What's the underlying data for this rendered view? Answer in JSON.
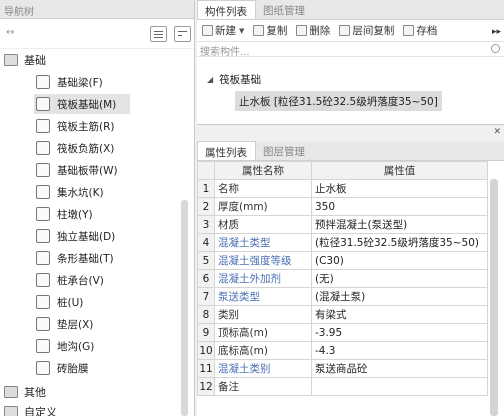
{
  "nav": {
    "title": "导航树",
    "categories": [
      {
        "label": "基础"
      },
      {
        "label": "其他"
      },
      {
        "label": "自定义"
      }
    ],
    "items": [
      {
        "label": "基础梁(F)",
        "icon": "beam-icon"
      },
      {
        "label": "筏板基础(M)",
        "icon": "raft-foundation-icon"
      },
      {
        "label": "筏板主筋(R)",
        "icon": "raft-main-rebar-icon"
      },
      {
        "label": "筏板负筋(X)",
        "icon": "raft-negative-rebar-icon"
      },
      {
        "label": "基础板带(W)",
        "icon": "slab-strip-icon"
      },
      {
        "label": "集水坑(K)",
        "icon": "sump-pit-icon"
      },
      {
        "label": "柱墩(Y)",
        "icon": "column-pier-icon"
      },
      {
        "label": "独立基础(D)",
        "icon": "isolated-footing-icon"
      },
      {
        "label": "条形基础(T)",
        "icon": "strip-footing-icon"
      },
      {
        "label": "桩承台(V)",
        "icon": "pile-cap-icon"
      },
      {
        "label": "桩(U)",
        "icon": "pile-icon"
      },
      {
        "label": "垫层(X)",
        "icon": "cushion-icon"
      },
      {
        "label": "地沟(G)",
        "icon": "trench-icon"
      },
      {
        "label": "砖胎膜",
        "icon": "brick-mold-icon"
      }
    ]
  },
  "components": {
    "tabs": [
      "构件列表",
      "图纸管理"
    ],
    "toolbar": {
      "new_label": "新建",
      "copy_label": "复制",
      "delete_label": "删除",
      "layer_copy_label": "层间复制",
      "save_label": "存档"
    },
    "search_placeholder": "搜索构件...",
    "group_label": "筏板基础",
    "item_label": "止水板 [粒径31.5砼32.5级坍落度35~50]"
  },
  "properties": {
    "tabs": [
      "属性列表",
      "图层管理"
    ],
    "columns": [
      "属性名称",
      "属性值"
    ],
    "rows": [
      {
        "num": "1",
        "name": "名称",
        "value": "止水板",
        "blue": false
      },
      {
        "num": "2",
        "name": "厚度(mm)",
        "value": "350",
        "blue": false
      },
      {
        "num": "3",
        "name": "材质",
        "value": "预拌混凝土(泵送型)",
        "blue": false
      },
      {
        "num": "4",
        "name": "混凝土类型",
        "value": "(粒径31.5砼32.5级坍落度35~50)",
        "blue": true
      },
      {
        "num": "5",
        "name": "混凝土强度等级",
        "value": "(C30)",
        "blue": true
      },
      {
        "num": "6",
        "name": "混凝土外加剂",
        "value": "(无)",
        "blue": true
      },
      {
        "num": "7",
        "name": "泵送类型",
        "value": "(混凝土泵)",
        "blue": true
      },
      {
        "num": "8",
        "name": "类别",
        "value": "有梁式",
        "blue": false
      },
      {
        "num": "9",
        "name": "顶标高(m)",
        "value": "-3.95",
        "blue": false
      },
      {
        "num": "10",
        "name": "底标高(m)",
        "value": "-4.3",
        "blue": false
      },
      {
        "num": "11",
        "name": "混凝土类别",
        "value": "泵送商品砼",
        "blue": true
      },
      {
        "num": "12",
        "name": "备注",
        "value": "",
        "blue": false
      }
    ]
  }
}
